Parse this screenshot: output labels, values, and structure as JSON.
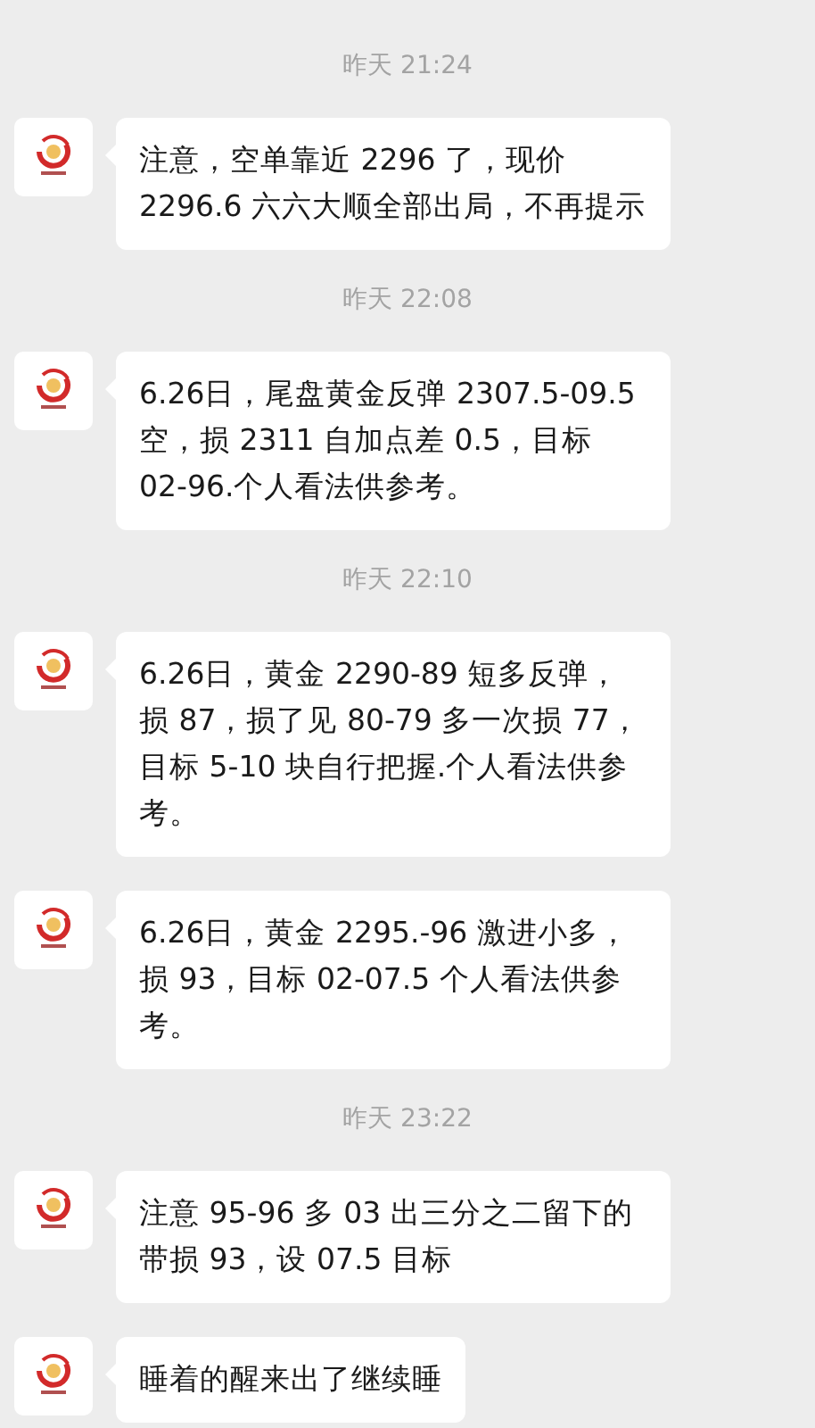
{
  "messages": [
    {
      "kind": "time",
      "text": "昨天 21:24"
    },
    {
      "kind": "message",
      "text": "注意，空单靠近 2296 了，现价 2296.6 六六大顺全部出局，不再提示"
    },
    {
      "kind": "time",
      "text": "昨天 22:08"
    },
    {
      "kind": "message",
      "text": "6.26日，尾盘黄金反弹 2307.5-09.5 空，损 2311 自加点差 0.5，目标 02-96.个人看法供参考。"
    },
    {
      "kind": "time",
      "text": "昨天 22:10"
    },
    {
      "kind": "message",
      "text": "6.26日，黄金 2290-89 短多反弹，损 87，损了见 80-79 多一次损 77，目标 5-10 块自行把握.个人看法供参考。"
    },
    {
      "kind": "message",
      "text": "6.26日，黄金 2295.-96 激进小多，损 93，目标 02-07.5 个人看法供参考。"
    },
    {
      "kind": "time",
      "text": "昨天 23:22"
    },
    {
      "kind": "message",
      "text": "注意 95-96 多 03 出三分之二留下的带损 93，设 07.5 目标"
    },
    {
      "kind": "message",
      "text": "睡着的醒来出了继续睡"
    }
  ]
}
